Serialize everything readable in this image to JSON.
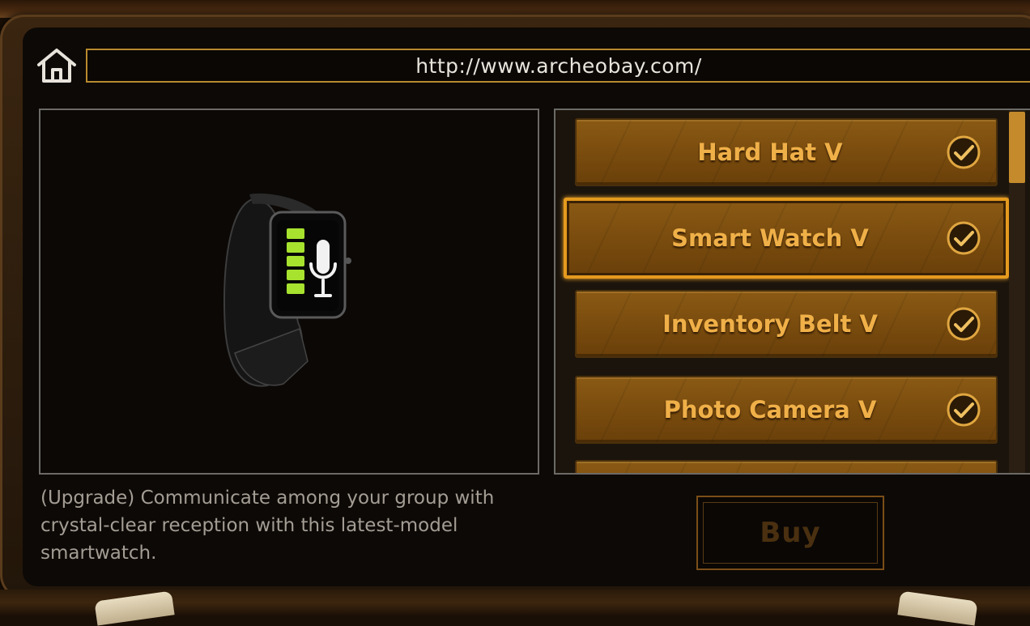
{
  "browser": {
    "url": "http://www.archeobay.com/",
    "home_icon": "home-icon"
  },
  "product_list": [
    {
      "label": "Hard Hat V",
      "owned": true,
      "selected": false
    },
    {
      "label": "Smart Watch V",
      "owned": true,
      "selected": true
    },
    {
      "label": "Inventory Belt V",
      "owned": true,
      "selected": false
    },
    {
      "label": "Photo Camera V",
      "owned": true,
      "selected": false
    }
  ],
  "detail": {
    "description": "(Upgrade) Communicate among your group with crystal-clear reception with this latest-model smartwatch.",
    "preview_icons": [
      "smartwatch-icon",
      "microphone-icon"
    ],
    "battery_bars": 5
  },
  "actions": {
    "buy_label": "Buy",
    "buy_enabled": false
  },
  "colors": {
    "accent": "#e59a1e",
    "item_text": "#f0b048",
    "battery_green": "#a6e22e"
  }
}
